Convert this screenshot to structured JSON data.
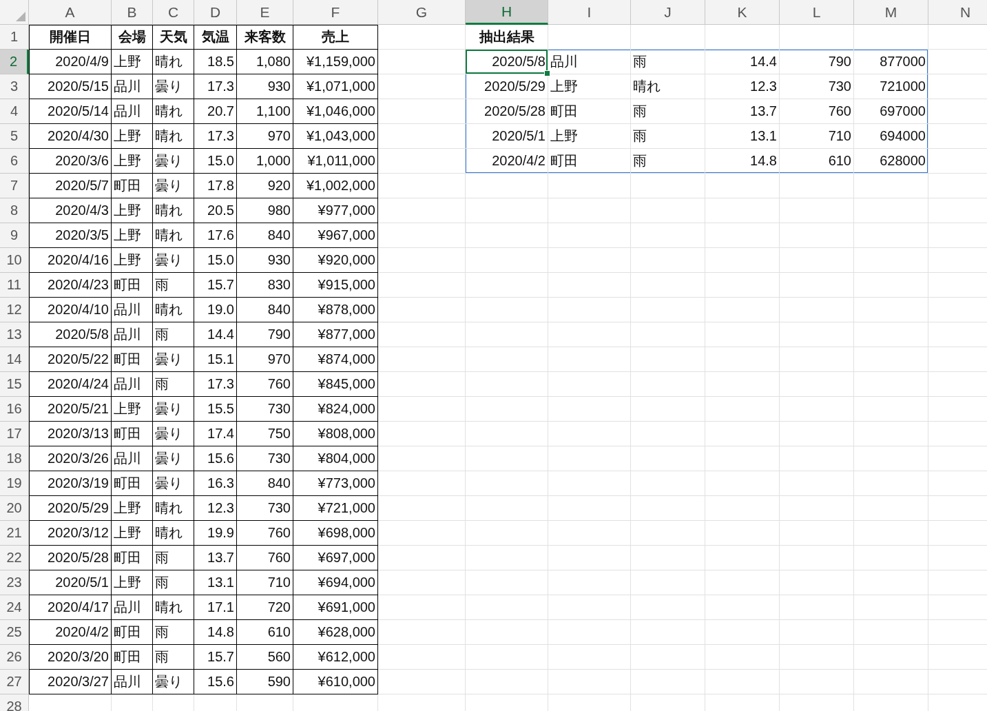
{
  "columns": [
    {
      "label": "A",
      "selected": false,
      "bordered": true,
      "in_selection": false
    },
    {
      "label": "B",
      "selected": false,
      "bordered": true,
      "in_selection": false
    },
    {
      "label": "C",
      "selected": false,
      "bordered": true,
      "in_selection": false
    },
    {
      "label": "D",
      "selected": false,
      "bordered": true,
      "in_selection": false
    },
    {
      "label": "E",
      "selected": false,
      "bordered": true,
      "in_selection": false
    },
    {
      "label": "F",
      "selected": false,
      "bordered": true,
      "in_selection": false
    },
    {
      "label": "G",
      "selected": false,
      "bordered": false,
      "in_selection": false
    },
    {
      "label": "H",
      "selected": true,
      "bordered": false,
      "in_selection": true
    },
    {
      "label": "I",
      "selected": false,
      "bordered": false,
      "in_selection": true
    },
    {
      "label": "J",
      "selected": false,
      "bordered": false,
      "in_selection": true
    },
    {
      "label": "K",
      "selected": false,
      "bordered": false,
      "in_selection": true
    },
    {
      "label": "L",
      "selected": false,
      "bordered": false,
      "in_selection": true
    },
    {
      "label": "M",
      "selected": false,
      "bordered": false,
      "in_selection": true
    },
    {
      "label": "N",
      "selected": false,
      "bordered": false,
      "in_selection": false
    }
  ],
  "rows": [
    {
      "number": "1",
      "kind": "header",
      "selected": false,
      "bordered": true,
      "in_selection": false,
      "cells": [
        "開催日",
        "会場",
        "天気",
        "気温",
        "来客数",
        "売上",
        null,
        "抽出結果"
      ]
    },
    {
      "number": "2",
      "kind": "data",
      "selected": true,
      "bordered": true,
      "in_selection": true,
      "cells": [
        "2020/4/9",
        "上野",
        "晴れ",
        "18.5",
        "1,080",
        "¥1,159,000",
        null,
        "2020/5/8",
        "品川",
        "雨",
        "14.4",
        "790",
        "877000"
      ]
    },
    {
      "number": "3",
      "kind": "data",
      "selected": false,
      "bordered": true,
      "in_selection": true,
      "cells": [
        "2020/5/15",
        "品川",
        "曇り",
        "17.3",
        "930",
        "¥1,071,000",
        null,
        "2020/5/29",
        "上野",
        "晴れ",
        "12.3",
        "730",
        "721000"
      ]
    },
    {
      "number": "4",
      "kind": "data",
      "selected": false,
      "bordered": true,
      "in_selection": true,
      "cells": [
        "2020/5/14",
        "品川",
        "晴れ",
        "20.7",
        "1,100",
        "¥1,046,000",
        null,
        "2020/5/28",
        "町田",
        "雨",
        "13.7",
        "760",
        "697000"
      ]
    },
    {
      "number": "5",
      "kind": "data",
      "selected": false,
      "bordered": true,
      "in_selection": true,
      "cells": [
        "2020/4/30",
        "上野",
        "晴れ",
        "17.3",
        "970",
        "¥1,043,000",
        null,
        "2020/5/1",
        "上野",
        "雨",
        "13.1",
        "710",
        "694000"
      ]
    },
    {
      "number": "6",
      "kind": "data",
      "selected": false,
      "bordered": true,
      "in_selection": true,
      "cells": [
        "2020/3/6",
        "上野",
        "曇り",
        "15.0",
        "1,000",
        "¥1,011,000",
        null,
        "2020/4/2",
        "町田",
        "雨",
        "14.8",
        "610",
        "628000"
      ]
    },
    {
      "number": "7",
      "kind": "data",
      "selected": false,
      "bordered": true,
      "in_selection": false,
      "cells": [
        "2020/5/7",
        "町田",
        "曇り",
        "17.8",
        "920",
        "¥1,002,000"
      ]
    },
    {
      "number": "8",
      "kind": "data",
      "selected": false,
      "bordered": true,
      "in_selection": false,
      "cells": [
        "2020/4/3",
        "上野",
        "晴れ",
        "20.5",
        "980",
        "¥977,000"
      ]
    },
    {
      "number": "9",
      "kind": "data",
      "selected": false,
      "bordered": true,
      "in_selection": false,
      "cells": [
        "2020/3/5",
        "上野",
        "晴れ",
        "17.6",
        "840",
        "¥967,000"
      ]
    },
    {
      "number": "10",
      "kind": "data",
      "selected": false,
      "bordered": true,
      "in_selection": false,
      "cells": [
        "2020/4/16",
        "上野",
        "曇り",
        "15.0",
        "930",
        "¥920,000"
      ]
    },
    {
      "number": "11",
      "kind": "data",
      "selected": false,
      "bordered": true,
      "in_selection": false,
      "cells": [
        "2020/4/23",
        "町田",
        "雨",
        "15.7",
        "830",
        "¥915,000"
      ]
    },
    {
      "number": "12",
      "kind": "data",
      "selected": false,
      "bordered": true,
      "in_selection": false,
      "cells": [
        "2020/4/10",
        "品川",
        "晴れ",
        "19.0",
        "840",
        "¥878,000"
      ]
    },
    {
      "number": "13",
      "kind": "data",
      "selected": false,
      "bordered": true,
      "in_selection": false,
      "cells": [
        "2020/5/8",
        "品川",
        "雨",
        "14.4",
        "790",
        "¥877,000"
      ]
    },
    {
      "number": "14",
      "kind": "data",
      "selected": false,
      "bordered": true,
      "in_selection": false,
      "cells": [
        "2020/5/22",
        "町田",
        "曇り",
        "15.1",
        "970",
        "¥874,000"
      ]
    },
    {
      "number": "15",
      "kind": "data",
      "selected": false,
      "bordered": true,
      "in_selection": false,
      "cells": [
        "2020/4/24",
        "品川",
        "雨",
        "17.3",
        "760",
        "¥845,000"
      ]
    },
    {
      "number": "16",
      "kind": "data",
      "selected": false,
      "bordered": true,
      "in_selection": false,
      "cells": [
        "2020/5/21",
        "上野",
        "曇り",
        "15.5",
        "730",
        "¥824,000"
      ]
    },
    {
      "number": "17",
      "kind": "data",
      "selected": false,
      "bordered": true,
      "in_selection": false,
      "cells": [
        "2020/3/13",
        "町田",
        "曇り",
        "17.4",
        "750",
        "¥808,000"
      ]
    },
    {
      "number": "18",
      "kind": "data",
      "selected": false,
      "bordered": true,
      "in_selection": false,
      "cells": [
        "2020/3/26",
        "品川",
        "曇り",
        "15.6",
        "730",
        "¥804,000"
      ]
    },
    {
      "number": "19",
      "kind": "data",
      "selected": false,
      "bordered": true,
      "in_selection": false,
      "cells": [
        "2020/3/19",
        "町田",
        "曇り",
        "16.3",
        "840",
        "¥773,000"
      ]
    },
    {
      "number": "20",
      "kind": "data",
      "selected": false,
      "bordered": true,
      "in_selection": false,
      "cells": [
        "2020/5/29",
        "上野",
        "晴れ",
        "12.3",
        "730",
        "¥721,000"
      ]
    },
    {
      "number": "21",
      "kind": "data",
      "selected": false,
      "bordered": true,
      "in_selection": false,
      "cells": [
        "2020/3/12",
        "上野",
        "晴れ",
        "19.9",
        "760",
        "¥698,000"
      ]
    },
    {
      "number": "22",
      "kind": "data",
      "selected": false,
      "bordered": true,
      "in_selection": false,
      "cells": [
        "2020/5/28",
        "町田",
        "雨",
        "13.7",
        "760",
        "¥697,000"
      ]
    },
    {
      "number": "23",
      "kind": "data",
      "selected": false,
      "bordered": true,
      "in_selection": false,
      "cells": [
        "2020/5/1",
        "上野",
        "雨",
        "13.1",
        "710",
        "¥694,000"
      ]
    },
    {
      "number": "24",
      "kind": "data",
      "selected": false,
      "bordered": true,
      "in_selection": false,
      "cells": [
        "2020/4/17",
        "品川",
        "晴れ",
        "17.1",
        "720",
        "¥691,000"
      ]
    },
    {
      "number": "25",
      "kind": "data",
      "selected": false,
      "bordered": true,
      "in_selection": false,
      "cells": [
        "2020/4/2",
        "町田",
        "雨",
        "14.8",
        "610",
        "¥628,000"
      ]
    },
    {
      "number": "26",
      "kind": "data",
      "selected": false,
      "bordered": true,
      "in_selection": false,
      "cells": [
        "2020/3/20",
        "町田",
        "雨",
        "15.7",
        "560",
        "¥612,000"
      ]
    },
    {
      "number": "27",
      "kind": "data",
      "selected": false,
      "bordered": true,
      "in_selection": false,
      "cells": [
        "2020/3/27",
        "品川",
        "曇り",
        "15.6",
        "590",
        "¥610,000"
      ]
    },
    {
      "number": "28",
      "kind": "data",
      "selected": false,
      "bordered": false,
      "in_selection": false,
      "cells": []
    }
  ]
}
